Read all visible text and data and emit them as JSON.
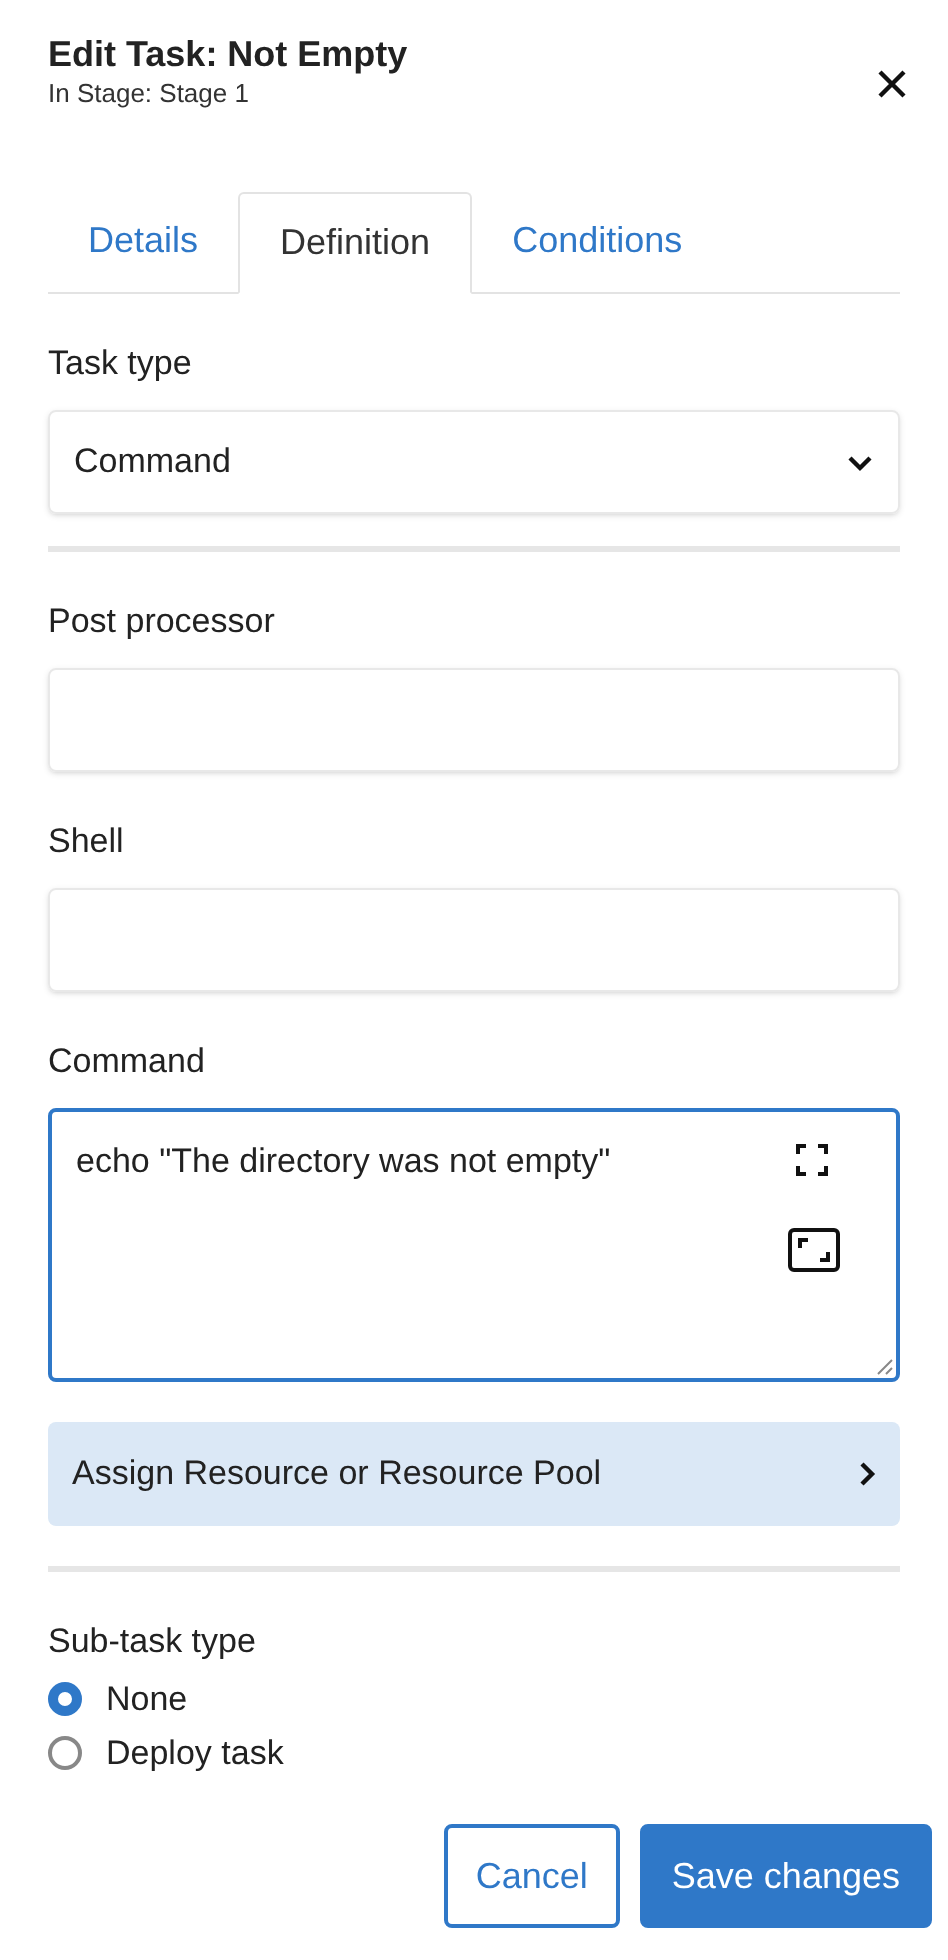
{
  "header": {
    "title": "Edit Task: Not Empty",
    "subtitle": "In Stage: Stage 1"
  },
  "tabs": [
    {
      "label": "Details",
      "selected": false
    },
    {
      "label": "Definition",
      "selected": true
    },
    {
      "label": "Conditions",
      "selected": false
    }
  ],
  "task_type": {
    "label": "Task type",
    "value": "Command"
  },
  "post_processor": {
    "label": "Post processor"
  },
  "shell": {
    "label": "Shell"
  },
  "command": {
    "label": "Command",
    "value": "echo \"The directory was not empty\""
  },
  "assign_resource": {
    "label": "Assign Resource or Resource Pool"
  },
  "sub_task_type": {
    "label": "Sub-task type",
    "options": [
      {
        "label": "None",
        "selected": true
      },
      {
        "label": "Deploy task",
        "selected": false
      }
    ]
  },
  "buttons": [
    {
      "label": "Cancel",
      "kind": "secondary"
    },
    {
      "label": "Save changes",
      "kind": "primary"
    }
  ]
}
